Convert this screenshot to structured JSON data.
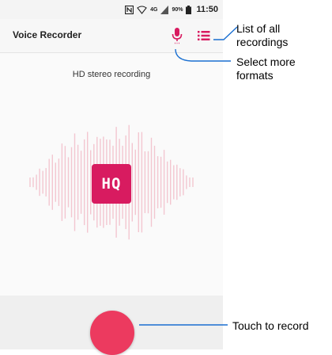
{
  "status_bar": {
    "network": "4G",
    "battery": "90%",
    "time": "11:50"
  },
  "app_bar": {
    "title": "Voice Recorder",
    "mic_icon": "microphone-icon",
    "list_icon": "list-icon"
  },
  "main": {
    "subtitle": "HD stereo recording",
    "quality_badge": "HQ"
  },
  "callouts": {
    "list": "List of all recordings",
    "formats": "Select more formats",
    "record": "Touch to record"
  },
  "colors": {
    "accent": "#d81b60",
    "record": "#ec3a5f",
    "wave": "#f3c6d0",
    "callout_line": "#1a6fd1"
  }
}
